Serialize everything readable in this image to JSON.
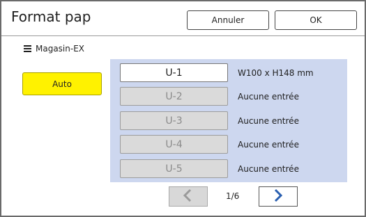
{
  "dialog": {
    "title": "Format pap",
    "cancel_label": "Annuler",
    "ok_label": "OK"
  },
  "tray": {
    "icon": "tray-icon",
    "label": "Magasin-EX"
  },
  "auto_button": {
    "label": "Auto",
    "color": "#fff200"
  },
  "slots": [
    {
      "label": "U-1",
      "description": "W100 x H148 mm",
      "state": "selected"
    },
    {
      "label": "U-2",
      "description": "Aucune entrée",
      "state": "disabled"
    },
    {
      "label": "U-3",
      "description": "Aucune entrée",
      "state": "disabled"
    },
    {
      "label": "U-4",
      "description": "Aucune entrée",
      "state": "disabled"
    },
    {
      "label": "U-5",
      "description": "Aucune entrée",
      "state": "disabled"
    }
  ],
  "pager": {
    "page": "1/6",
    "prev_icon": "chevron-left-icon",
    "next_icon": "chevron-right-icon",
    "accent": "#2a5fb0"
  },
  "colors": {
    "panel": "#cdd7ef",
    "disabled_slot": "#dadada"
  }
}
